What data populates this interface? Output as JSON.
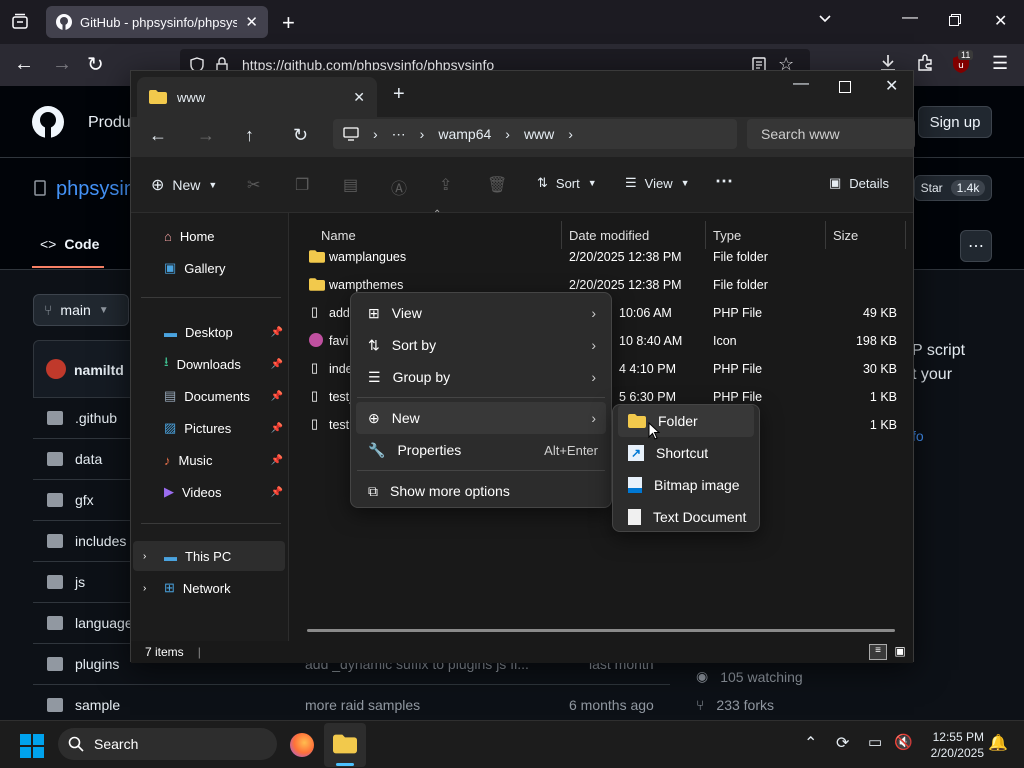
{
  "browser": {
    "tab_title": "GitHub - phpsysinfo/phpsysinfo",
    "url": "https://github.com/phpsysinfo/phpsysinfo",
    "badge_count": "11"
  },
  "github": {
    "nav_product": "Produ",
    "sign_in": "Sign up",
    "repo_name": "phpsysin",
    "code_tab": "Code",
    "branch": "main",
    "star_label": "Star",
    "star_count": "1.4k",
    "commit_author": "namiltd",
    "files": [
      ".github",
      "data",
      "gfx",
      "includes",
      "js",
      "language",
      "plugins",
      "sample"
    ],
    "plugins_commit": "add _dynamic suffix to plugins js fi...",
    "plugins_time": "last month",
    "sample_commit": "more raid samples",
    "sample_time": "6 months ago",
    "about_line1": "P script",
    "about_line2": "t your",
    "about_link": "fo",
    "watching": "105 watching",
    "forks": "233 forks"
  },
  "explorer": {
    "tab_title": "www",
    "breadcrumbs": [
      "wamp64",
      "www"
    ],
    "search_placeholder": "Search www",
    "toolbar": {
      "new": "New",
      "sort": "Sort",
      "view": "View",
      "details": "Details"
    },
    "sidebar": {
      "home": "Home",
      "gallery": "Gallery",
      "pinned": [
        "Desktop",
        "Downloads",
        "Documents",
        "Pictures",
        "Music",
        "Videos"
      ],
      "this_pc": "This PC",
      "network": "Network"
    },
    "columns": {
      "name": "Name",
      "date": "Date modified",
      "type": "Type",
      "size": "Size"
    },
    "rows": [
      {
        "name": "wamplangues",
        "date": "2/20/2025 12:38 PM",
        "type": "File folder",
        "size": ""
      },
      {
        "name": "wampthemes",
        "date": "2/20/2025 12:38 PM",
        "type": "File folder",
        "size": ""
      },
      {
        "name": "add",
        "date": "10:06 AM",
        "type": "PHP File",
        "size": "49 KB"
      },
      {
        "name": "favi",
        "date": "10 8:40 AM",
        "type": "Icon",
        "size": "198 KB"
      },
      {
        "name": "inde",
        "date": "4 4:10 PM",
        "type": "PHP File",
        "size": "30 KB"
      },
      {
        "name": "test_",
        "date": "5 6:30 PM",
        "type": "PHP File",
        "size": "1 KB"
      },
      {
        "name": "testr",
        "date": "",
        "type": "",
        "size": "1 KB"
      }
    ],
    "status": "7 items"
  },
  "context_menu": {
    "view": "View",
    "sort_by": "Sort by",
    "group_by": "Group by",
    "new": "New",
    "properties": "Properties",
    "properties_shortcut": "Alt+Enter",
    "more_options": "Show more options"
  },
  "submenu": {
    "folder": "Folder",
    "shortcut": "Shortcut",
    "bitmap": "Bitmap image",
    "text_doc": "Text Document"
  },
  "taskbar": {
    "search": "Search",
    "time": "12:55 PM",
    "date": "2/20/2025"
  },
  "colors": {
    "folder": "#f2c94c",
    "accent": "#0078d4",
    "win_blue": "#00a2ed"
  }
}
